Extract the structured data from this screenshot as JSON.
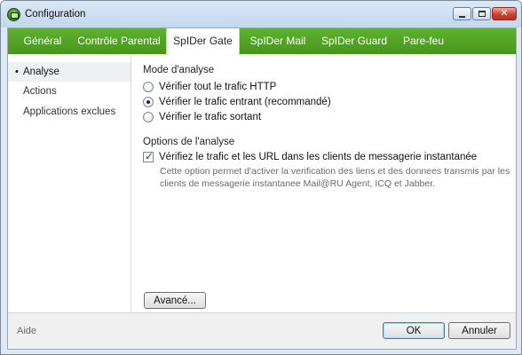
{
  "window": {
    "title": "Configuration",
    "icon": "spider-icon",
    "controls": [
      "minimize-icon",
      "maximize-icon",
      "close-icon"
    ]
  },
  "tabs": [
    {
      "label": "Général"
    },
    {
      "label": "Contrôle Parental"
    },
    {
      "label": "SpIDer Gate",
      "active": true
    },
    {
      "label": "SpIDer Mail"
    },
    {
      "label": "SpIDer Guard"
    },
    {
      "label": "Pare-feu"
    }
  ],
  "sidebar": {
    "items": [
      {
        "label": "Analyse",
        "active": true
      },
      {
        "label": "Actions"
      },
      {
        "label": "Applications exclues"
      }
    ]
  },
  "main": {
    "mode_title": "Mode d'analyse",
    "modes": [
      {
        "label": "Vérifier tout le trafic HTTP",
        "selected": false
      },
      {
        "label": "Vérifier le trafic entrant (recommandé)",
        "selected": true
      },
      {
        "label": "Vérifier le trafic sortant",
        "selected": false
      }
    ],
    "options_title": "Options de l'analyse",
    "option_check_label": "Vérifiez le trafic et les URL dans les clients de messagerie instantanée",
    "option_checked": true,
    "option_description": "Cette option permet d'activer la verification des liens et des donnees transmis par les clients de messagerie instantanee Mail@RU Agent, ICQ et Jabber.",
    "advanced_label": "Avancé..."
  },
  "footer": {
    "help_label": "Aide",
    "ok_label": "OK",
    "cancel_label": "Annuler"
  },
  "colors": {
    "tab_green": "#4fa224",
    "title_bar": "#c8dbef",
    "description_text": "#6a6a6a"
  }
}
